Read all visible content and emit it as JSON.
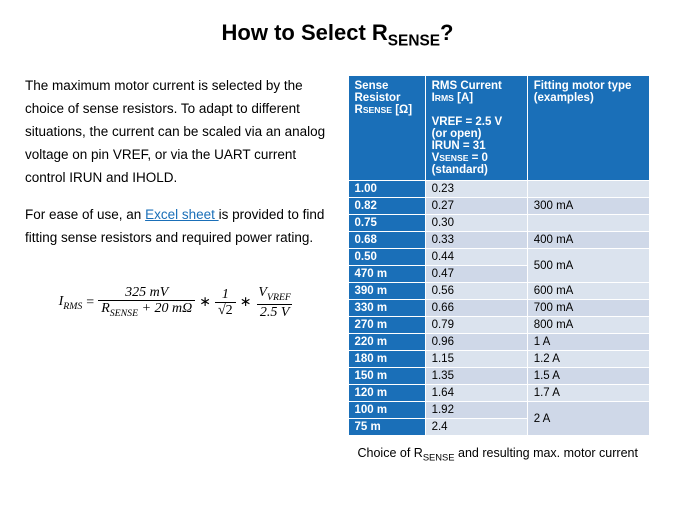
{
  "title_prefix": "How to Select R",
  "title_sub": "SENSE",
  "title_suffix": "?",
  "intro1_a": "The maximum motor current is selected by the choice of sense resistors. To adapt to different situations, the current can be scaled via an analog voltage on pin VREF, or via the UART current control IRUN and IHOLD.",
  "intro2_a": "For ease of use, an ",
  "intro2_link": "Excel sheet ",
  "intro2_b": "is provided to find fitting sense resistors and required power rating.",
  "formula": {
    "lhs_base": "I",
    "lhs_sub": "RMS",
    "eq": " = ",
    "f1_num": "325 mV",
    "f1_den_a": "R",
    "f1_den_sub": "SENSE",
    "f1_den_b": " + 20 mΩ",
    "mult": " ∗ ",
    "f2_num": "1",
    "f2_den": "√2",
    "f3_num_a": "V",
    "f3_num_sub": "VREF",
    "f3_den": "2.5 V"
  },
  "headers": {
    "col1_a": "Sense Resistor",
    "col1_b": "R",
    "col1_sub": "SENSE",
    "col1_c": " [Ω]",
    "col2_a": "RMS Current",
    "col2_b": "I",
    "col2_b_sub": "RMS",
    "col2_b2": " [A]",
    "col2_c": "VREF = 2.5 V (or open)",
    "col2_d": "IRUN = 31",
    "col2_e1": "V",
    "col2_e_sub": "SENSE",
    "col2_e2": " = 0 (standard)",
    "col3": "Fitting motor type (examples)"
  },
  "rows": [
    {
      "r": "1.00",
      "i": "0.23",
      "m": ""
    },
    {
      "r": "0.82",
      "i": "0.27",
      "m": "300 mA"
    },
    {
      "r": "0.75",
      "i": "0.30",
      "m": ""
    },
    {
      "r": "0.68",
      "i": "0.33",
      "m": "400 mA"
    },
    {
      "r": "0.50",
      "i": "0.44",
      "m": ""
    },
    {
      "r": "470 m",
      "i": "0.47",
      "m": "500 mA"
    },
    {
      "r": "390 m",
      "i": "0.56",
      "m": "600 mA"
    },
    {
      "r": "330 m",
      "i": "0.66",
      "m": "700 mA"
    },
    {
      "r": "270 m",
      "i": "0.79",
      "m": "800 mA"
    },
    {
      "r": "220 m",
      "i": "0.96",
      "m": "1 A"
    },
    {
      "r": "180 m",
      "i": "1.15",
      "m": "1.2 A"
    },
    {
      "r": "150 m",
      "i": "1.35",
      "m": "1.5 A"
    },
    {
      "r": "120 m",
      "i": "1.64",
      "m": "1.7 A"
    },
    {
      "r": "100 m",
      "i": "1.92",
      "m": ""
    },
    {
      "r": "75 m",
      "i": "2.4",
      "m": "2 A"
    }
  ],
  "merge": {
    "500mA": "500 mA",
    "2A": "2 A"
  },
  "caption_a": "Choice of R",
  "caption_sub": "SENSE",
  "caption_b": " and resulting max. motor current",
  "chart_data": {
    "type": "table",
    "title": "How to Select R_SENSE?",
    "columns": [
      "Sense Resistor R_SENSE [Ω]",
      "RMS Current I_RMS [A] (VREF=2.5V, IRUN=31, V_SENSE=0)",
      "Fitting motor type (examples)"
    ],
    "rows": [
      [
        "1.00",
        0.23,
        null
      ],
      [
        "0.82",
        0.27,
        "300 mA"
      ],
      [
        "0.75",
        0.3,
        null
      ],
      [
        "0.68",
        0.33,
        "400 mA"
      ],
      [
        "0.50",
        0.44,
        "500 mA"
      ],
      [
        "470 m",
        0.47,
        "500 mA"
      ],
      [
        "390 m",
        0.56,
        "600 mA"
      ],
      [
        "330 m",
        0.66,
        "700 mA"
      ],
      [
        "270 m",
        0.79,
        "800 mA"
      ],
      [
        "220 m",
        0.96,
        "1 A"
      ],
      [
        "180 m",
        1.15,
        "1.2 A"
      ],
      [
        "150 m",
        1.35,
        "1.5 A"
      ],
      [
        "120 m",
        1.64,
        "1.7 A"
      ],
      [
        "100 m",
        1.92,
        "2 A"
      ],
      [
        "75 m",
        2.4,
        "2 A"
      ]
    ],
    "formula": "I_RMS = (325 mV / (R_SENSE + 20 mΩ)) * (1/√2) * (V_VREF / 2.5 V)"
  }
}
